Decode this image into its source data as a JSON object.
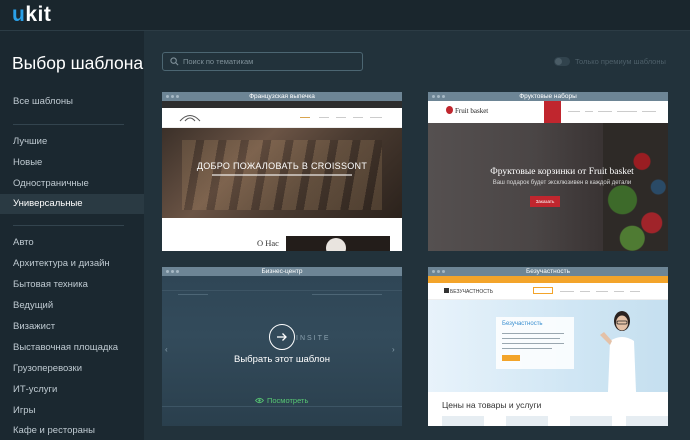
{
  "app": {
    "logo_u": "u",
    "logo_rest": "kit"
  },
  "sidebar": {
    "title": "Выбор шаблона",
    "all": "Все шаблоны",
    "groups": [
      {
        "label": "Лучшие"
      },
      {
        "label": "Новые"
      },
      {
        "label": "Одностраничные"
      },
      {
        "label": "Универсальные"
      }
    ],
    "categories": [
      {
        "label": "Авто"
      },
      {
        "label": "Архитектура и дизайн"
      },
      {
        "label": "Бытовая техника"
      },
      {
        "label": "Ведущий"
      },
      {
        "label": "Визажист"
      },
      {
        "label": "Выставочная площадка"
      },
      {
        "label": "Грузоперевозки"
      },
      {
        "label": "ИТ-услуги"
      },
      {
        "label": "Игры"
      },
      {
        "label": "Кафе и рестораны"
      }
    ],
    "active": "Универсальные"
  },
  "search": {
    "placeholder": "Поиск по тематикам"
  },
  "premium_toggle": {
    "label": "Только премиум шаблоны",
    "on": false
  },
  "templates": [
    {
      "title": "Французская выпечка",
      "brand": "CROISSONT",
      "hero_title": "ДОБРО ПОЖАЛОВАТЬ В CROISSONT",
      "section": "О Нас"
    },
    {
      "title": "Фруктовые наборы",
      "brand": "Fruit basket",
      "hero_title": "Фруктовые корзинки от Fruit basket",
      "hero_sub": "Ваш подарок будет эксклюзивен в каждой детали",
      "cta": "Заказать"
    },
    {
      "title": "Бизнес-центр",
      "watermark": "INSITE",
      "overlay_choose": "Выбрать этот шаблон",
      "overlay_view": "Посмотреть"
    },
    {
      "title": "Безучастность",
      "brand": "БЕЗУЧАСТНОСТЬ",
      "panel_title": "Безучастность",
      "heading": "Цены на товары и услуги"
    }
  ],
  "colors": {
    "accent": "#2aa0e8",
    "view_green": "#57c773",
    "card_title_bar": "#6d8595"
  }
}
